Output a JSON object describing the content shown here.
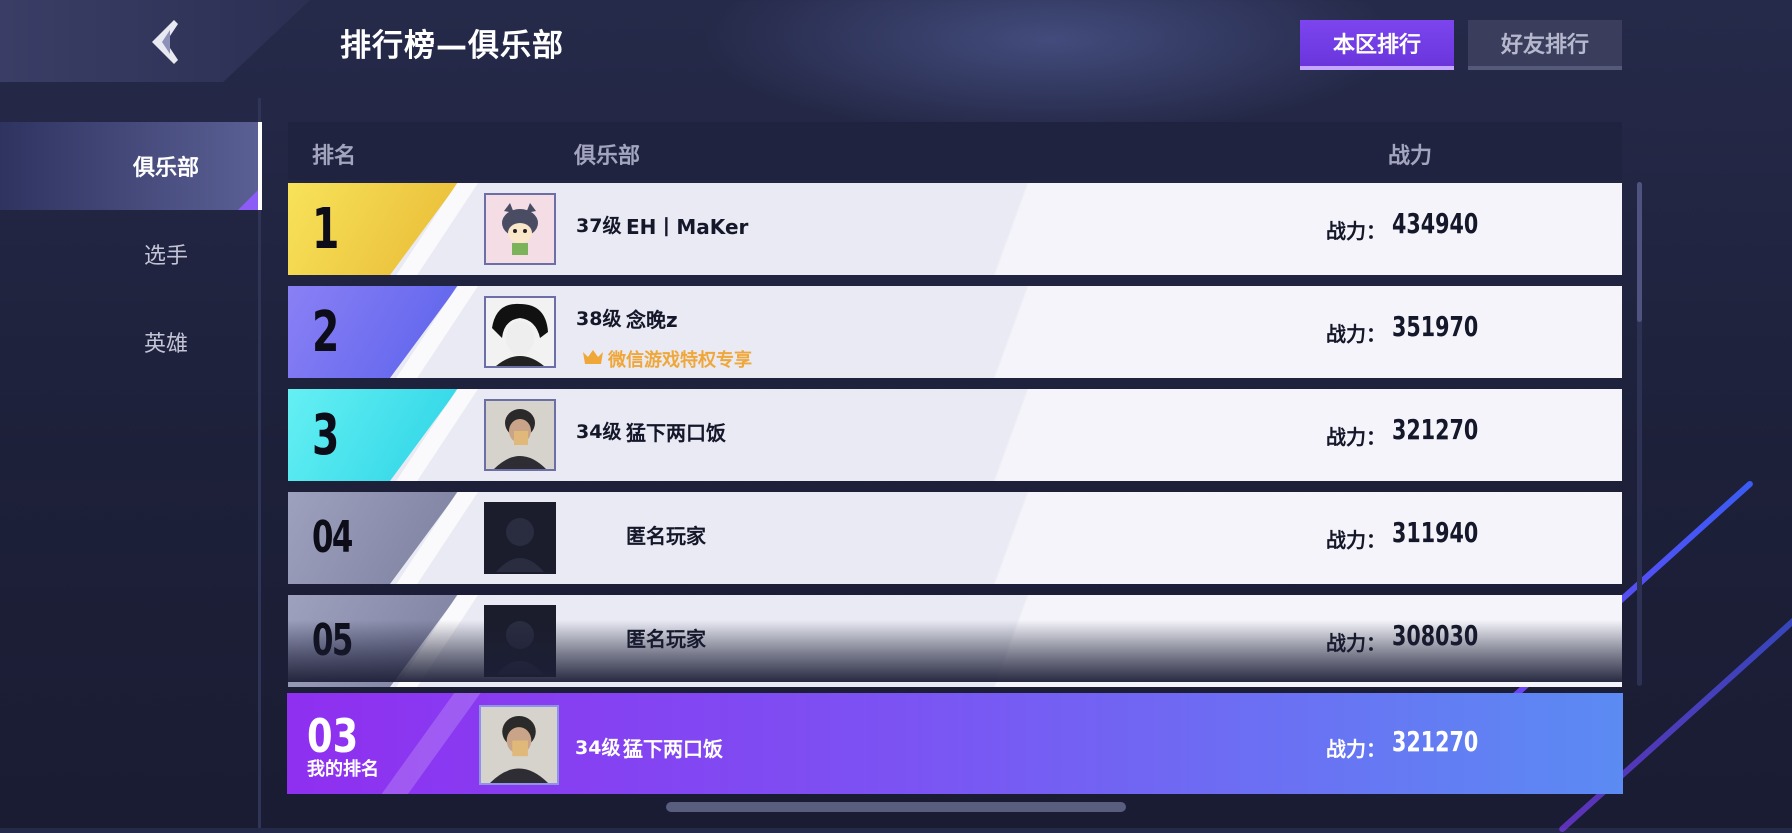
{
  "header": {
    "title": "排行榜—俱乐部"
  },
  "tabs": [
    {
      "label": "本区排行",
      "active": true
    },
    {
      "label": "好友排行",
      "active": false
    }
  ],
  "sidebar": {
    "items": [
      {
        "label": "俱乐部",
        "active": true
      },
      {
        "label": "选手",
        "active": false
      },
      {
        "label": "英雄",
        "active": false
      }
    ]
  },
  "table": {
    "columns": {
      "rank": "排名",
      "club": "俱乐部",
      "power": "战力"
    },
    "rows": [
      {
        "rank": "1",
        "level": "37级",
        "name": "EH丨MaKer",
        "privilege": "",
        "power_label": "战力：",
        "power": "434940",
        "rank_color": "#f2d142"
      },
      {
        "rank": "2",
        "level": "38级",
        "name": "念晚z",
        "privilege": "微信游戏特权专享",
        "power_label": "战力：",
        "power": "351970",
        "rank_color": "#6c6ff2"
      },
      {
        "rank": "3",
        "level": "34级",
        "name": "猛下两口饭",
        "privilege": "",
        "power_label": "战力：",
        "power": "321270",
        "rank_color": "#39e3ee"
      },
      {
        "rank": "04",
        "level": "",
        "name": "匿名玩家",
        "privilege": "",
        "power_label": "战力：",
        "power": "311940",
        "rank_color": "#8c8fae"
      },
      {
        "rank": "05",
        "level": "",
        "name": "匿名玩家",
        "privilege": "",
        "power_label": "战力：",
        "power": "308030",
        "rank_color": "#8c8fae"
      }
    ]
  },
  "my_rank": {
    "rank": "03",
    "label": "我的排名",
    "level": "34级",
    "name": "猛下两口饭",
    "power_label": "战力：",
    "power": "321270"
  },
  "colors": {
    "accent": "#7c45ee",
    "privilege": "#f0a73a"
  }
}
